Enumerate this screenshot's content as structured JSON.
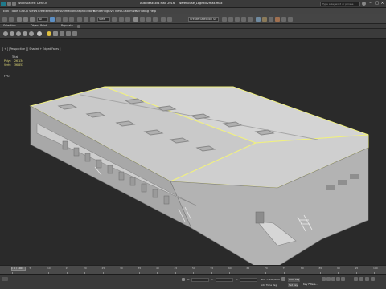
{
  "title_bar": {
    "workspace_dropdown": "Workspaces: Default",
    "app_title": "Autodesk 3ds Max 2016",
    "file_name": "Warehouse_Logistic2max.max",
    "search_placeholder": "Type a keyword or phrase"
  },
  "menu": [
    "Edit",
    "Tools",
    "Group",
    "Views",
    "Create",
    "Modifiers",
    "Animation",
    "Graph Editors",
    "Rendering",
    "Civil View",
    "Customize",
    "Scripting",
    "Help"
  ],
  "toolbar": {
    "selection_filter": "All",
    "view_dropdown": "View",
    "selection_set": "Create Selection Se"
  },
  "ribbon_tabs": [
    "Selection",
    "Object Paint",
    "Populate"
  ],
  "viewport": {
    "label": "[ + ] [Perspective ] [ Shaded + Edged Faces ]",
    "stats": {
      "header": "Total",
      "polys_label": "Polys:",
      "polys_value": "26,134",
      "verts_label": "Verts:",
      "verts_value": "36,853",
      "fps_label": "FPS:"
    }
  },
  "timeline": {
    "slider": "0 / 100",
    "frames": [
      "0",
      "5",
      "10",
      "15",
      "20",
      "25",
      "30",
      "35",
      "40",
      "45",
      "50",
      "55",
      "60",
      "65",
      "70",
      "75",
      "80",
      "85",
      "90",
      "95",
      "100"
    ]
  },
  "status": {
    "x_label": "X:",
    "y_label": "Y:",
    "z_label": "Z:",
    "grid": "Grid = 100,0cm",
    "add_time_tag": "Add Time Tag",
    "auto_key": "Auto Key",
    "set_key": "Set Key",
    "key_filters": "Key Filters..."
  },
  "colors": {
    "selection_edge": "#f0f080",
    "stats_text": "#e7df7a",
    "viewport_bg": "#2a2a2a",
    "building": "#cfcfcf"
  }
}
